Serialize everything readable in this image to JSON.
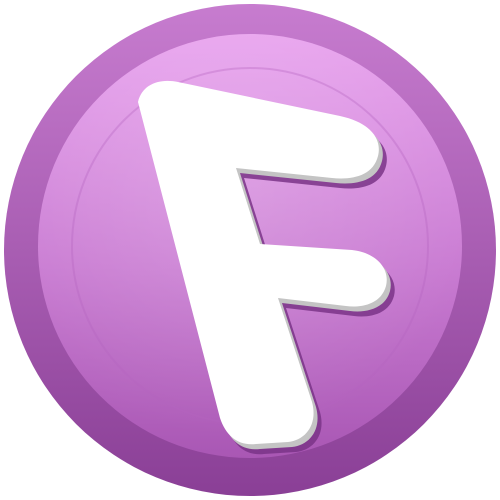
{
  "logo": {
    "letter": "F",
    "icon": "letter-f-logo-icon",
    "colors": {
      "outer_ring_top": "#c77ccf",
      "outer_ring_bottom": "#8a3f96",
      "inner_disc_top": "#e8a2ee",
      "inner_disc_mid": "#c97bd2",
      "inner_disc_bottom": "#a957b4",
      "letter_fill": "#ffffff",
      "letter_shadow": "#c4c4c4",
      "letter_deep_shadow": "#7a3487"
    }
  }
}
